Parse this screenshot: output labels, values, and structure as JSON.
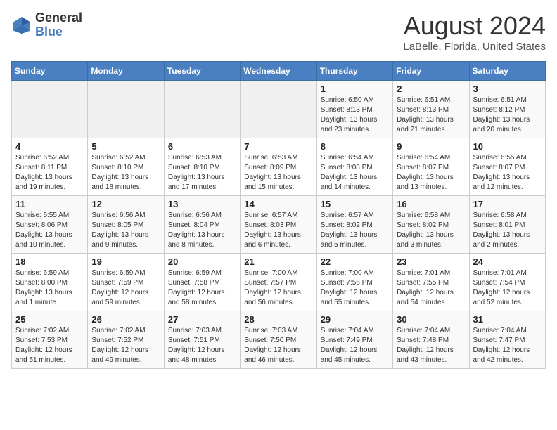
{
  "header": {
    "logo_general": "General",
    "logo_blue": "Blue",
    "month_title": "August 2024",
    "location": "LaBelle, Florida, United States"
  },
  "days_of_week": [
    "Sunday",
    "Monday",
    "Tuesday",
    "Wednesday",
    "Thursday",
    "Friday",
    "Saturday"
  ],
  "weeks": [
    [
      {
        "day": "",
        "info": ""
      },
      {
        "day": "",
        "info": ""
      },
      {
        "day": "",
        "info": ""
      },
      {
        "day": "",
        "info": ""
      },
      {
        "day": "1",
        "info": "Sunrise: 6:50 AM\nSunset: 8:13 PM\nDaylight: 13 hours\nand 23 minutes."
      },
      {
        "day": "2",
        "info": "Sunrise: 6:51 AM\nSunset: 8:13 PM\nDaylight: 13 hours\nand 21 minutes."
      },
      {
        "day": "3",
        "info": "Sunrise: 6:51 AM\nSunset: 8:12 PM\nDaylight: 13 hours\nand 20 minutes."
      }
    ],
    [
      {
        "day": "4",
        "info": "Sunrise: 6:52 AM\nSunset: 8:11 PM\nDaylight: 13 hours\nand 19 minutes."
      },
      {
        "day": "5",
        "info": "Sunrise: 6:52 AM\nSunset: 8:10 PM\nDaylight: 13 hours\nand 18 minutes."
      },
      {
        "day": "6",
        "info": "Sunrise: 6:53 AM\nSunset: 8:10 PM\nDaylight: 13 hours\nand 17 minutes."
      },
      {
        "day": "7",
        "info": "Sunrise: 6:53 AM\nSunset: 8:09 PM\nDaylight: 13 hours\nand 15 minutes."
      },
      {
        "day": "8",
        "info": "Sunrise: 6:54 AM\nSunset: 8:08 PM\nDaylight: 13 hours\nand 14 minutes."
      },
      {
        "day": "9",
        "info": "Sunrise: 6:54 AM\nSunset: 8:07 PM\nDaylight: 13 hours\nand 13 minutes."
      },
      {
        "day": "10",
        "info": "Sunrise: 6:55 AM\nSunset: 8:07 PM\nDaylight: 13 hours\nand 12 minutes."
      }
    ],
    [
      {
        "day": "11",
        "info": "Sunrise: 6:55 AM\nSunset: 8:06 PM\nDaylight: 13 hours\nand 10 minutes."
      },
      {
        "day": "12",
        "info": "Sunrise: 6:56 AM\nSunset: 8:05 PM\nDaylight: 13 hours\nand 9 minutes."
      },
      {
        "day": "13",
        "info": "Sunrise: 6:56 AM\nSunset: 8:04 PM\nDaylight: 13 hours\nand 8 minutes."
      },
      {
        "day": "14",
        "info": "Sunrise: 6:57 AM\nSunset: 8:03 PM\nDaylight: 13 hours\nand 6 minutes."
      },
      {
        "day": "15",
        "info": "Sunrise: 6:57 AM\nSunset: 8:02 PM\nDaylight: 13 hours\nand 5 minutes."
      },
      {
        "day": "16",
        "info": "Sunrise: 6:58 AM\nSunset: 8:02 PM\nDaylight: 13 hours\nand 3 minutes."
      },
      {
        "day": "17",
        "info": "Sunrise: 6:58 AM\nSunset: 8:01 PM\nDaylight: 13 hours\nand 2 minutes."
      }
    ],
    [
      {
        "day": "18",
        "info": "Sunrise: 6:59 AM\nSunset: 8:00 PM\nDaylight: 13 hours\nand 1 minute."
      },
      {
        "day": "19",
        "info": "Sunrise: 6:59 AM\nSunset: 7:59 PM\nDaylight: 12 hours\nand 59 minutes."
      },
      {
        "day": "20",
        "info": "Sunrise: 6:59 AM\nSunset: 7:58 PM\nDaylight: 12 hours\nand 58 minutes."
      },
      {
        "day": "21",
        "info": "Sunrise: 7:00 AM\nSunset: 7:57 PM\nDaylight: 12 hours\nand 56 minutes."
      },
      {
        "day": "22",
        "info": "Sunrise: 7:00 AM\nSunset: 7:56 PM\nDaylight: 12 hours\nand 55 minutes."
      },
      {
        "day": "23",
        "info": "Sunrise: 7:01 AM\nSunset: 7:55 PM\nDaylight: 12 hours\nand 54 minutes."
      },
      {
        "day": "24",
        "info": "Sunrise: 7:01 AM\nSunset: 7:54 PM\nDaylight: 12 hours\nand 52 minutes."
      }
    ],
    [
      {
        "day": "25",
        "info": "Sunrise: 7:02 AM\nSunset: 7:53 PM\nDaylight: 12 hours\nand 51 minutes."
      },
      {
        "day": "26",
        "info": "Sunrise: 7:02 AM\nSunset: 7:52 PM\nDaylight: 12 hours\nand 49 minutes."
      },
      {
        "day": "27",
        "info": "Sunrise: 7:03 AM\nSunset: 7:51 PM\nDaylight: 12 hours\nand 48 minutes."
      },
      {
        "day": "28",
        "info": "Sunrise: 7:03 AM\nSunset: 7:50 PM\nDaylight: 12 hours\nand 46 minutes."
      },
      {
        "day": "29",
        "info": "Sunrise: 7:04 AM\nSunset: 7:49 PM\nDaylight: 12 hours\nand 45 minutes."
      },
      {
        "day": "30",
        "info": "Sunrise: 7:04 AM\nSunset: 7:48 PM\nDaylight: 12 hours\nand 43 minutes."
      },
      {
        "day": "31",
        "info": "Sunrise: 7:04 AM\nSunset: 7:47 PM\nDaylight: 12 hours\nand 42 minutes."
      }
    ]
  ]
}
